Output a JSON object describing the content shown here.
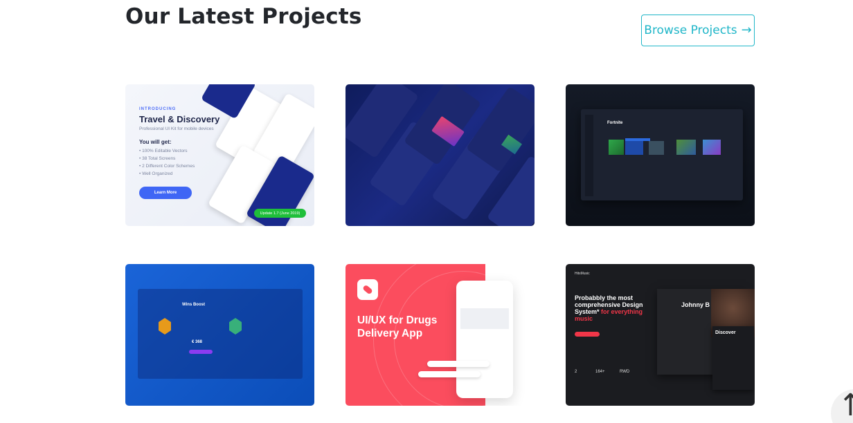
{
  "section": {
    "title": "Our Latest Projects",
    "browse_label": "Browse Projects",
    "browse_icon": "arrow-right-icon"
  },
  "projects": [
    {
      "name": "travel-discovery",
      "introducing": "INTRODUCING",
      "title": "Travel & Discovery",
      "subtitle": "Professional UI Kit for mobile devices",
      "get_heading": "You will get:",
      "features": [
        "• 100% Editable Vectors",
        "• 38 Total Screens",
        "• 2 Different Color Schemes",
        "• Well Organized"
      ],
      "cta": "Learn More",
      "badge": "Update 1.7 (June 2019)"
    },
    {
      "name": "dark-mobile-ui"
    },
    {
      "name": "fortnite-dashboard",
      "game_title": "Fortnite"
    },
    {
      "name": "wins-boost",
      "heading": "Wins Boost",
      "price": "€ 368"
    },
    {
      "name": "drugs-delivery",
      "headline": "UI/UX for Drugs Delivery App"
    },
    {
      "name": "hitsmusic",
      "brand": "HitsMusic",
      "headline_main": "Probabbly the most comprehensive Design System*",
      "headline_accent": "for everything music",
      "artist": "Johnny B",
      "discover": "Discover",
      "stats": [
        "2",
        "164+",
        "RWD"
      ]
    }
  ],
  "colors": {
    "accent": "#1fb6c8",
    "title": "#23262b"
  },
  "scroll_top_icon": "arrow-up-icon"
}
